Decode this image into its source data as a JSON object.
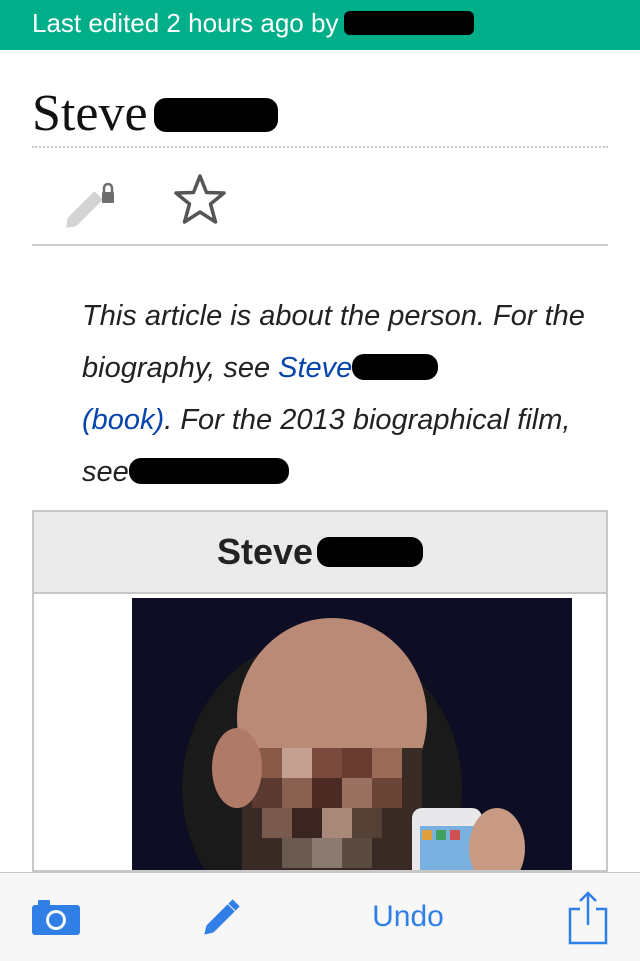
{
  "banner": {
    "text": "Last edited 2 hours ago by",
    "color": "#00af89"
  },
  "article": {
    "title": "Steve"
  },
  "hatnote": {
    "text1": "This article is about the person. For the biography, see ",
    "link1": "Steve",
    "link1_suffix": "(book)",
    "text2": ". For the 2013 biographical film, see"
  },
  "infobox": {
    "title": "Steve"
  },
  "bottom_bar": {
    "undo_label": "Undo",
    "accent": "#2f7fe6"
  },
  "icons": [
    "edit-lock-icon",
    "star-icon",
    "camera-icon",
    "pencil-icon",
    "share-icon"
  ]
}
